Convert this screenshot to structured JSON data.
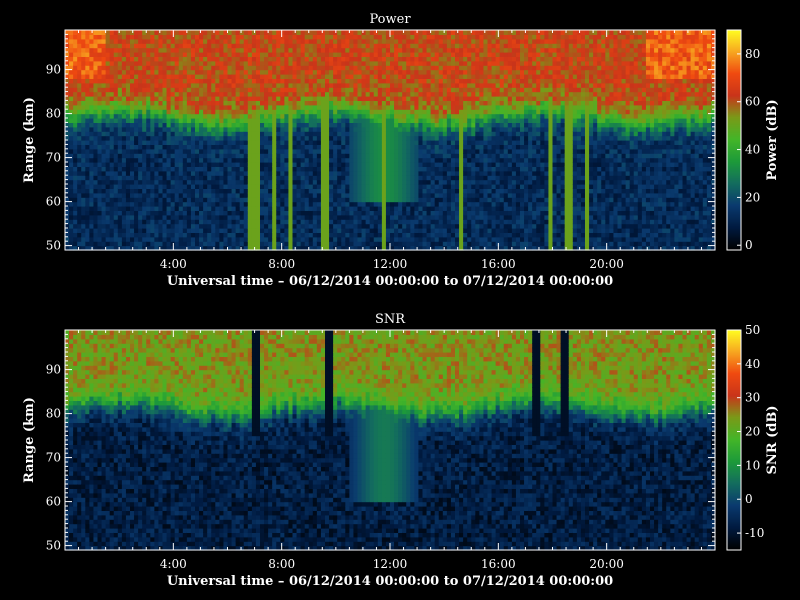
{
  "chart_data": [
    {
      "type": "heatmap",
      "title": "Power",
      "xlabel": "Universal time – 06/12/2014 00:00:00 to 07/12/2014 00:00:00",
      "ylabel": "Range (km)",
      "x_ticks": [
        {
          "hour": 4,
          "label": "4:00"
        },
        {
          "hour": 8,
          "label": "8:00"
        },
        {
          "hour": 12,
          "label": "12:00"
        },
        {
          "hour": 16,
          "label": "16:00"
        },
        {
          "hour": 20,
          "label": "20:00"
        }
      ],
      "xlim_hours": [
        0,
        24
      ],
      "y_ticks": [
        50,
        60,
        70,
        80,
        90
      ],
      "ylim": [
        49,
        99
      ],
      "colorbar": {
        "label": "Power (dB)",
        "ticks": [
          0,
          20,
          40,
          60,
          80
        ],
        "range": [
          -2,
          90
        ]
      },
      "upper_layer_level": 62,
      "lower_layer_level": 12,
      "transition_range_km": 79,
      "strong_columns_hours": [
        6.9,
        7.1,
        7.7,
        8.3,
        9.6,
        11.8,
        14.6,
        17.9,
        18.6,
        19.3
      ],
      "colormap": [
        "#000000",
        "#001a40",
        "#0a3a6e",
        "#136c5e",
        "#1d9a3a",
        "#43b528",
        "#7a9a18",
        "#c9341a",
        "#f04a10",
        "#f7a820",
        "#ffff20"
      ]
    },
    {
      "type": "heatmap",
      "title": "SNR",
      "xlabel": "Universal time – 06/12/2014 00:00:00 to 07/12/2014 00:00:00",
      "ylabel": "Range (km)",
      "x_ticks": [
        {
          "hour": 4,
          "label": "4:00"
        },
        {
          "hour": 8,
          "label": "8:00"
        },
        {
          "hour": 12,
          "label": "12:00"
        },
        {
          "hour": 16,
          "label": "16:00"
        },
        {
          "hour": 20,
          "label": "20:00"
        }
      ],
      "xlim_hours": [
        0,
        24
      ],
      "y_ticks": [
        50,
        60,
        70,
        80,
        90
      ],
      "ylim": [
        49,
        99
      ],
      "colorbar": {
        "label": "SNR (dB)",
        "ticks": [
          -10,
          0,
          10,
          20,
          30,
          40,
          50
        ],
        "range": [
          -15,
          50
        ]
      },
      "upper_layer_level": 24,
      "lower_layer_level": -8,
      "transition_range_km": 81,
      "dark_gaps_hours": [
        7.0,
        9.8,
        17.4,
        18.5
      ],
      "colormap": [
        "#000000",
        "#001a40",
        "#0a3a6e",
        "#136c5e",
        "#1d9a3a",
        "#43b528",
        "#7a9a18",
        "#c9341a",
        "#f04a10",
        "#f7a820",
        "#ffff20"
      ]
    }
  ]
}
